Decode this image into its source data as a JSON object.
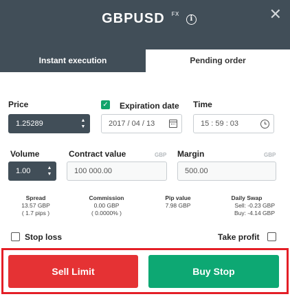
{
  "header": {
    "symbol": "GBPUSD",
    "type": "FX",
    "info_icon": "info-icon",
    "close_icon": "close-icon"
  },
  "tabs": [
    {
      "label": "Instant execution",
      "active": false
    },
    {
      "label": "Pending order",
      "active": true
    }
  ],
  "price": {
    "label": "Price",
    "value": "1.25289"
  },
  "expiration": {
    "label": "Expiration date",
    "checked": true,
    "value": "2017 / 04 / 13"
  },
  "time": {
    "label": "Time",
    "value": "15 : 59 : 03"
  },
  "volume": {
    "label": "Volume",
    "value": "1.00"
  },
  "contract_value": {
    "label": "Contract value",
    "currency": "GBP",
    "value": "100 000.00"
  },
  "margin": {
    "label": "Margin",
    "currency": "GBP",
    "value": "500.00"
  },
  "stats": {
    "spread": {
      "label": "Spread",
      "line1": "13.57 GBP",
      "line2": "( 1.7 pips )"
    },
    "commission": {
      "label": "Commission",
      "line1": "0.00 GBP",
      "line2": "( 0.0000% )"
    },
    "pip_value": {
      "label": "Pip value",
      "line1": "7.98 GBP"
    },
    "daily_swap": {
      "label": "Daily Swap",
      "line1": "Sell: -0.23 GBP",
      "line2": "Buy: -4.14 GBP"
    }
  },
  "options": {
    "stop_loss": {
      "label": "Stop loss",
      "checked": false
    },
    "take_profit": {
      "label": "Take profit",
      "checked": false
    }
  },
  "buttons": {
    "sell": "Sell Limit",
    "buy": "Buy Stop"
  },
  "colors": {
    "header_bg": "#414e58",
    "sell": "#e53234",
    "buy": "#0da873",
    "checkbox_checked": "#12a46c",
    "highlight_border": "#e41e26"
  }
}
